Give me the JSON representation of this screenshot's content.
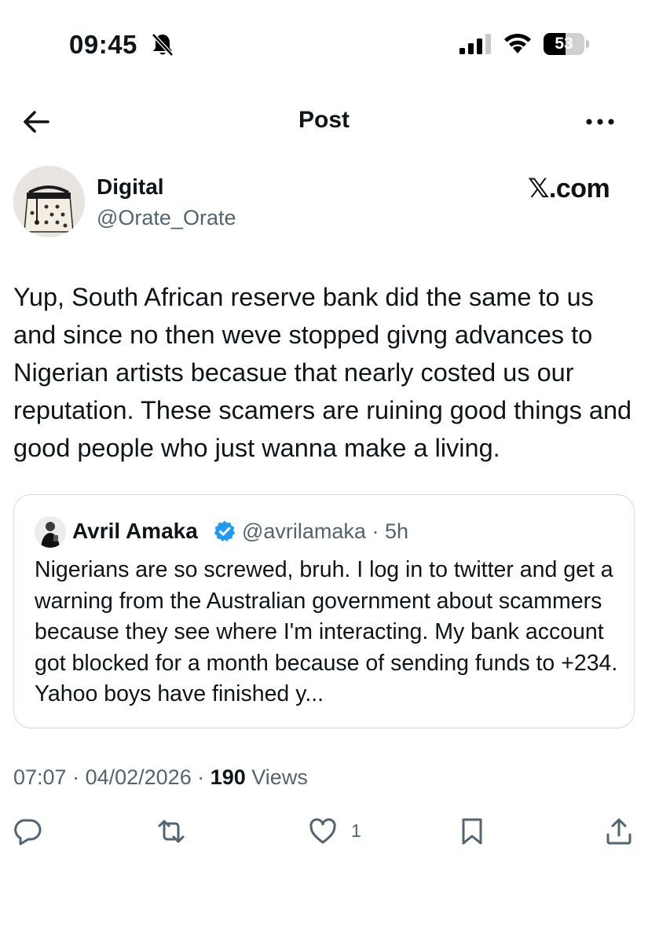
{
  "status_bar": {
    "time": "09:45",
    "battery_level": "53",
    "battery_fraction": 0.53
  },
  "header": {
    "title": "Post"
  },
  "author": {
    "name": "Digital",
    "handle": "@Orate_Orate"
  },
  "watermark": "𝕏.com",
  "post": {
    "text": "Yup, South African reserve bank did the same to us and since no then weve stopped givng advances to Nigerian artists becasue that nearly costed us our reputation. These scamers are ruining good things and good people who just wanna make a living."
  },
  "quote": {
    "name": "Avril Amaka",
    "verified": true,
    "handle_time": "@avrilamaka · 5h",
    "text": "Nigerians are so screwed, bruh. I log in to twitter and get a warning from the Australian government about scammers because they see where I'm interacting. My bank account got blocked for a month because of sending funds to +234. Yahoo boys have finished y..."
  },
  "meta": {
    "time": "07:07",
    "sep1": " · ",
    "date": "04/02/2026",
    "sep2": " · ",
    "views_count": "190",
    "views_label": " Views"
  },
  "actions": {
    "like_count": "1"
  },
  "colors": {
    "text_primary": "#0f1419",
    "text_secondary": "#536471",
    "border": "#cfd9de",
    "verified": "#1d9bf0"
  },
  "icons": [
    "bell-slash-icon",
    "signal-icon",
    "wifi-icon",
    "back-arrow-icon",
    "more-icon",
    "verified-badge-icon",
    "reply-icon",
    "repost-icon",
    "like-icon",
    "bookmark-icon",
    "share-icon"
  ]
}
